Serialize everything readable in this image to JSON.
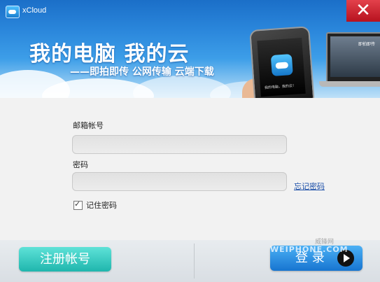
{
  "window": {
    "title": "xCloud",
    "close_label": "✕"
  },
  "banner": {
    "headline": "我的电脑  我的云",
    "subline": "——即拍即传  公网传输  云端下载",
    "phone_caption": "我的电脑，我的云！",
    "laptop_text": "即拍即传"
  },
  "form": {
    "email_label": "邮箱帐号",
    "email_value": "",
    "password_label": "密码",
    "password_value": "",
    "forgot_password": "忘记密码",
    "remember_password": "记住密码",
    "remember_checked": true
  },
  "actions": {
    "register_label": "注册帐号",
    "login_label": "登 录"
  },
  "watermark": {
    "site": "WEIPHONE.COM",
    "brand": "威锋网"
  }
}
